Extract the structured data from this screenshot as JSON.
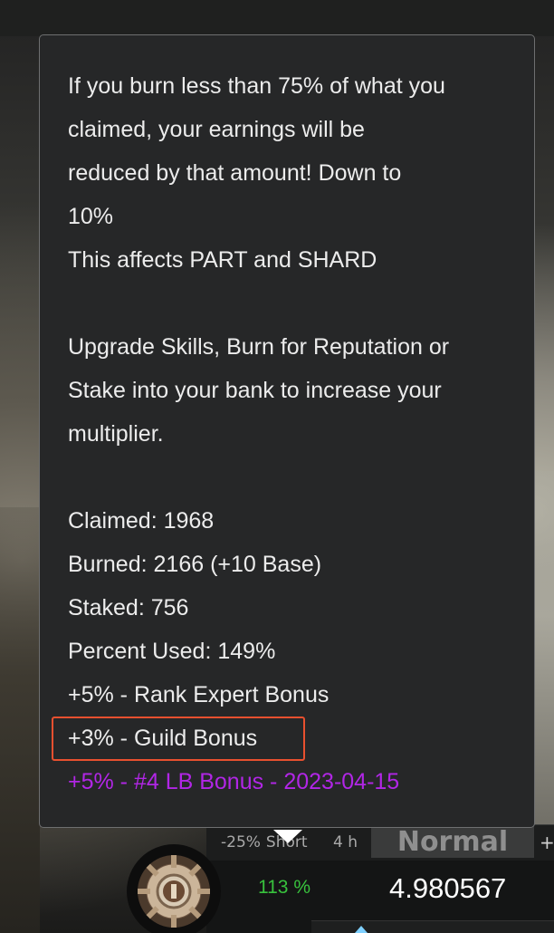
{
  "tooltip": {
    "paragraph1": [
      "If you burn less than 75% of what you",
      "claimed, your earnings will be",
      "reduced by that amount! Down to",
      "10%",
      "This affects PART and SHARD"
    ],
    "paragraph2": [
      "Upgrade Skills, Burn for Reputation or",
      "Stake into your bank to increase your",
      "multiplier."
    ],
    "stats": {
      "claimed": "Claimed: 1968",
      "burned": "Burned: 2166 (+10 Base)",
      "staked": "Staked: 756",
      "percent_used": "Percent Used: 149%"
    },
    "bonuses": {
      "rank": "+5% - Rank Expert Bonus",
      "guild": "+3% - Guild Bonus",
      "leaderboard": "+5% - #4 LB Bonus - 2023-04-15"
    }
  },
  "hud": {
    "tab_short_pct": "-25%",
    "tab_short_label": "Short",
    "tab_time": "4 h",
    "tab_normal": "Normal",
    "tab_plus": "+",
    "multiplier": "113 %",
    "value": "4.980567"
  },
  "colors": {
    "tooltip_bg": "#262728",
    "text": "#ececec",
    "purple": "#b126e6",
    "highlight": "#e8502f",
    "green": "#38c23d"
  },
  "icons": {
    "gear": "gear-badge-icon",
    "down_arrow": "triangle-down-icon",
    "up_arrow": "triangle-up-icon"
  }
}
